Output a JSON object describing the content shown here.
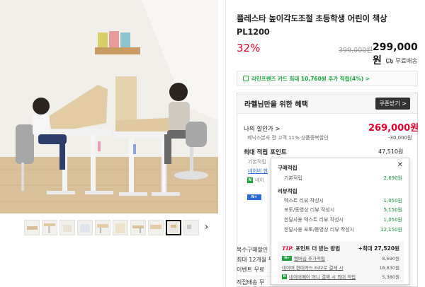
{
  "product": {
    "title": "플레스타 높이각도조절 초등학생 어린이 책상 PL1200",
    "discount": "32%",
    "original_price": "399,000원",
    "sale_price": "299,000원",
    "shipping": "무료배송"
  },
  "card_banner": "라인프렌즈 카드 최대 10,760원 추가 적립(4%) >",
  "benefits": {
    "heading": "라헬님만을 위한 혜택",
    "coupon_button": "쿠폰받기 >",
    "my_price_label": "나의 할인가 >",
    "my_price": "269,000원",
    "discount_line": "제닉스본사 전 고객 11% 상품중복할인",
    "discount_value": "-30,000원",
    "max_points_label": "최대 적립 포인트",
    "max_points_value": "47,510원",
    "mini_lines": [
      "기본적립",
      "네이버 현",
      "네이"
    ]
  },
  "bottom_info": [
    "복수구매할인",
    "최대 12개월 무",
    "이벤트  무료",
    "직접배송  무"
  ],
  "popover": {
    "purchase_title": "구매적립",
    "purchase_items": [
      {
        "label": "기본적립",
        "value": "2,690원"
      }
    ],
    "review_title": "리뷰적립",
    "review_items": [
      {
        "label": "텍스트 리뷰 작성시",
        "value": "1,050원"
      },
      {
        "label": "포토/동영상 리뷰 작성시",
        "value": "5,150원"
      },
      {
        "label": "한달사용 텍스트 리뷰 작성시",
        "value": "1,050원"
      },
      {
        "label": "한달사용 포토/동영상 리뷰 작성시",
        "value": "12,150원"
      }
    ],
    "tip_mark": "TIP.",
    "tip_title": "포인트 더 받는 방법",
    "tip_total": "+최대 27,520원",
    "tip_items": [
      {
        "label": "멤버십 추가적립",
        "value": "8,690원"
      },
      {
        "label": "네이버 현대카드 Ed2로 결제 시",
        "value": "18,830원"
      },
      {
        "label": "네이버페이 머니 결제 시 최대 적립",
        "value": "5,380원"
      }
    ]
  },
  "icons": {
    "close": "close-icon",
    "truck": "truck-icon",
    "next": "chevron-right-icon",
    "npay": "naver-pay-icon"
  },
  "colors": {
    "accent_red": "#e6002d",
    "naver_green": "#20a341",
    "link_blue": "#2a6bd6"
  }
}
